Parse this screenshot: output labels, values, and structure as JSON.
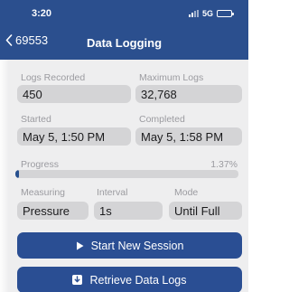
{
  "status_bar": {
    "time": "3:20",
    "network": "5G",
    "battery_level": 0.25
  },
  "nav": {
    "back_label": "69553",
    "title": "Data Logging"
  },
  "fields": {
    "logs_recorded": {
      "label": "Logs Recorded",
      "value": "450"
    },
    "maximum_logs": {
      "label": "Maximum Logs",
      "value": "32,768"
    },
    "started": {
      "label": "Started",
      "value": "May 5, 1:50 PM"
    },
    "completed": {
      "label": "Completed",
      "value": "May 5, 1:58 PM"
    },
    "measuring": {
      "label": "Measuring",
      "value": "Pressure"
    },
    "interval": {
      "label": "Interval",
      "value": "1s"
    },
    "mode": {
      "label": "Mode",
      "value": "Until Full"
    }
  },
  "progress": {
    "label": "Progress",
    "percent_text": "1.37%",
    "fraction": 0.0137
  },
  "buttons": {
    "start_new_session": "Start New Session",
    "retrieve_data_logs": "Retrieve Data Logs"
  },
  "colors": {
    "header": "#2b4f8e",
    "button": "#2a4e93",
    "background": "#eeeeef",
    "field": "#d4d4d6"
  },
  "icons": {
    "back": "chevron-left-icon",
    "start": "play-icon",
    "retrieve": "download-icon"
  }
}
